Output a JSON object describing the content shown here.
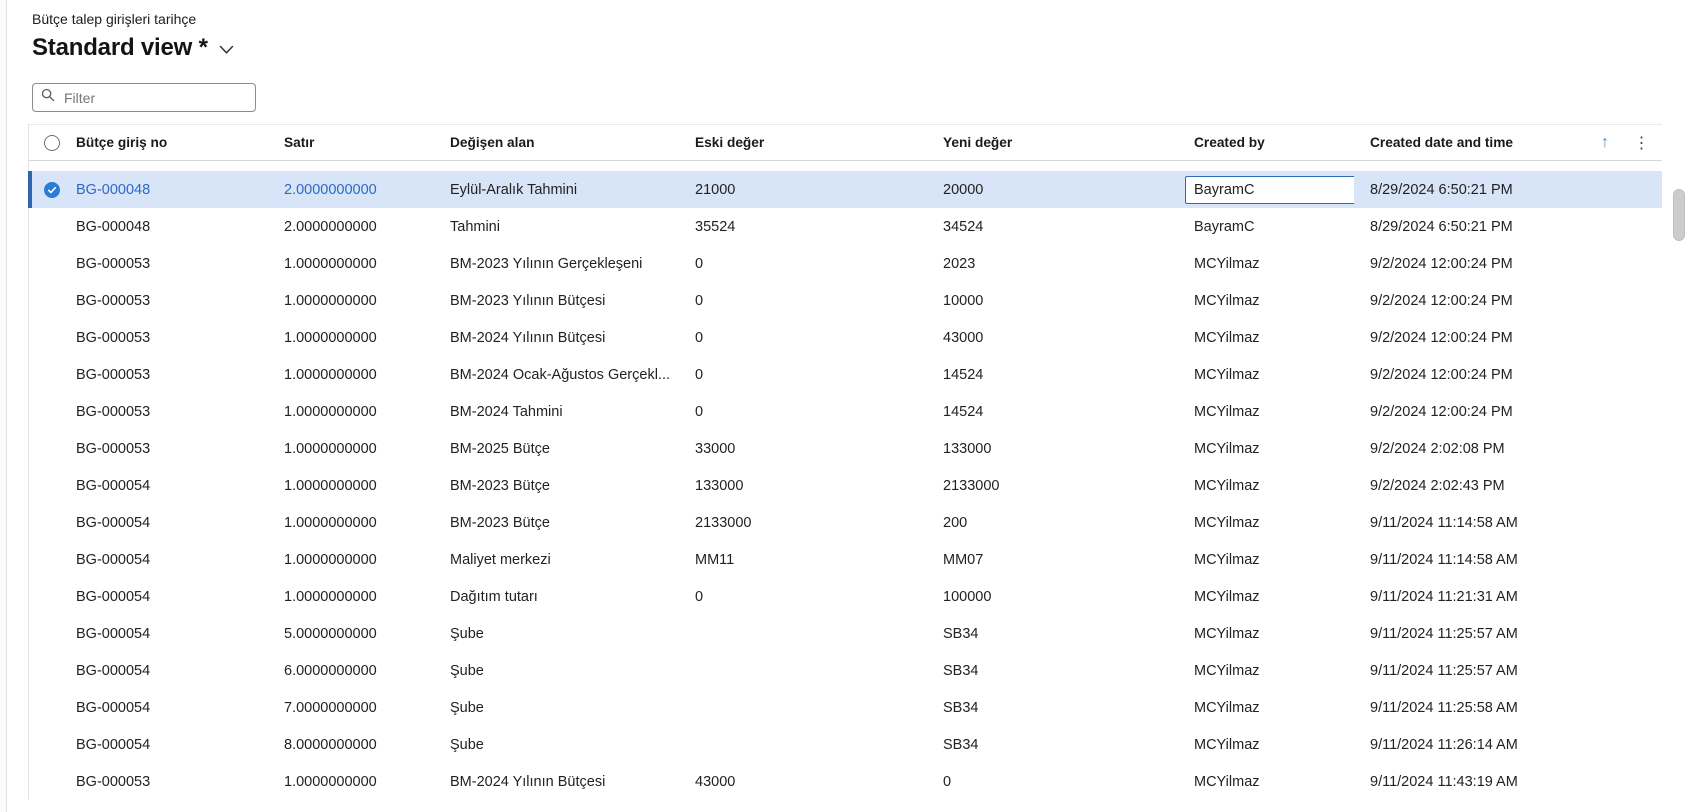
{
  "page": {
    "caption": "Bütçe talep girişleri tarihçe",
    "view_title": "Standard view *"
  },
  "filter": {
    "placeholder": "Filter"
  },
  "grid": {
    "columns": {
      "entry": "Bütçe giriş no",
      "line": "Satır",
      "field": "Değişen alan",
      "old": "Eski değer",
      "new": "Yeni değer",
      "by": "Created by",
      "at": "Created date and time"
    },
    "sort_ascending_icon": "↑",
    "more_options_icon": "⋮",
    "rows": [
      {
        "entry": "BG-000048",
        "line": "2.0000000000",
        "field": "Eylül-Aralık Tahmini",
        "old": "21000",
        "new": "20000",
        "by": "BayramC",
        "at": "8/29/2024 6:50:21 PM",
        "selected": true,
        "editing": true
      },
      {
        "entry": "BG-000048",
        "line": "2.0000000000",
        "field": "Tahmini",
        "old": "35524",
        "new": "34524",
        "by": "BayramC",
        "at": "8/29/2024 6:50:21 PM"
      },
      {
        "entry": "BG-000053",
        "line": "1.0000000000",
        "field": "BM-2023 Yılının Gerçekleşeni",
        "old": "0",
        "new": "2023",
        "by": "MCYilmaz",
        "at": "9/2/2024 12:00:24 PM"
      },
      {
        "entry": "BG-000053",
        "line": "1.0000000000",
        "field": "BM-2023 Yılının Bütçesi",
        "old": "0",
        "new": "10000",
        "by": "MCYilmaz",
        "at": "9/2/2024 12:00:24 PM"
      },
      {
        "entry": "BG-000053",
        "line": "1.0000000000",
        "field": "BM-2024 Yılının Bütçesi",
        "old": "0",
        "new": "43000",
        "by": "MCYilmaz",
        "at": "9/2/2024 12:00:24 PM"
      },
      {
        "entry": "BG-000053",
        "line": "1.0000000000",
        "field": "BM-2024 Ocak-Ağustos Gerçekl...",
        "old": "0",
        "new": "14524",
        "by": "MCYilmaz",
        "at": "9/2/2024 12:00:24 PM"
      },
      {
        "entry": "BG-000053",
        "line": "1.0000000000",
        "field": "BM-2024 Tahmini",
        "old": "0",
        "new": "14524",
        "by": "MCYilmaz",
        "at": "9/2/2024 12:00:24 PM"
      },
      {
        "entry": "BG-000053",
        "line": "1.0000000000",
        "field": "BM-2025 Bütçe",
        "old": "33000",
        "new": "133000",
        "by": "MCYilmaz",
        "at": "9/2/2024 2:02:08 PM"
      },
      {
        "entry": "BG-000054",
        "line": "1.0000000000",
        "field": "BM-2023 Bütçe",
        "old": "133000",
        "new": "2133000",
        "by": "MCYilmaz",
        "at": "9/2/2024 2:02:43 PM"
      },
      {
        "entry": "BG-000054",
        "line": "1.0000000000",
        "field": "BM-2023 Bütçe",
        "old": "2133000",
        "new": "200",
        "by": "MCYilmaz",
        "at": "9/11/2024 11:14:58 AM"
      },
      {
        "entry": "BG-000054",
        "line": "1.0000000000",
        "field": "Maliyet merkezi",
        "old": "MM11",
        "new": "MM07",
        "by": "MCYilmaz",
        "at": "9/11/2024 11:14:58 AM"
      },
      {
        "entry": "BG-000054",
        "line": "1.0000000000",
        "field": "Dağıtım tutarı",
        "old": "0",
        "new": "100000",
        "by": "MCYilmaz",
        "at": "9/11/2024 11:21:31 AM"
      },
      {
        "entry": "BG-000054",
        "line": "5.0000000000",
        "field": "Şube",
        "old": "",
        "new": "SB34",
        "by": "MCYilmaz",
        "at": "9/11/2024 11:25:57 AM"
      },
      {
        "entry": "BG-000054",
        "line": "6.0000000000",
        "field": "Şube",
        "old": "",
        "new": "SB34",
        "by": "MCYilmaz",
        "at": "9/11/2024 11:25:57 AM"
      },
      {
        "entry": "BG-000054",
        "line": "7.0000000000",
        "field": "Şube",
        "old": "",
        "new": "SB34",
        "by": "MCYilmaz",
        "at": "9/11/2024 11:25:58 AM"
      },
      {
        "entry": "BG-000054",
        "line": "8.0000000000",
        "field": "Şube",
        "old": "",
        "new": "SB34",
        "by": "MCYilmaz",
        "at": "9/11/2024 11:26:14 AM"
      },
      {
        "entry": "BG-000053",
        "line": "1.0000000000",
        "field": "BM-2024 Yılının Bütçesi",
        "old": "43000",
        "new": "0",
        "by": "MCYilmaz",
        "at": "9/11/2024 11:43:19 AM"
      }
    ]
  },
  "colors": {
    "selection_background": "#d8e4f8",
    "selection_accent_bar": "#2e66ad",
    "checkbox_checked": "#2a7cd4",
    "link_text": "#2b6bc4",
    "sort_arrow": "#4a86c8"
  }
}
